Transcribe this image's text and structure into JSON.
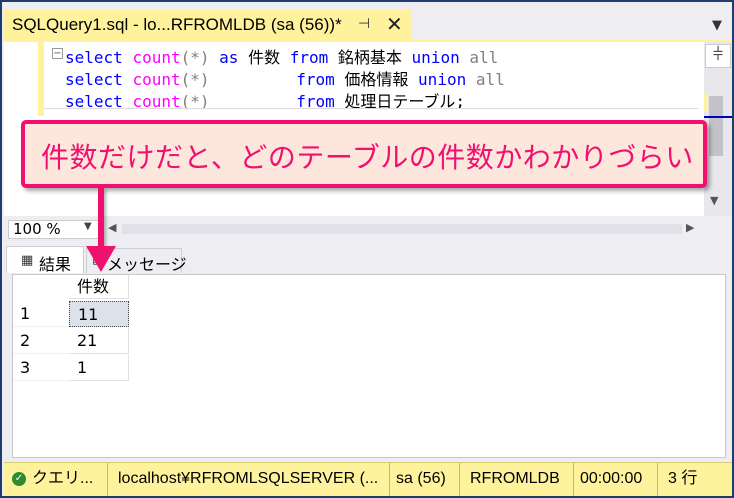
{
  "document_tab": {
    "title": "SQLQuery1.sql - lo...RFROMLDB (sa (56))*",
    "pin_glyph": "⊣",
    "close_glyph": "✕",
    "dropdown_glyph": "▼"
  },
  "editor": {
    "collapse_glyph": "−",
    "lines": [
      {
        "select": "select",
        "count": "count",
        "args": "(*)",
        "middle_kw": "as",
        "alias": "件数",
        "from": "from",
        "table": "銘柄基本",
        "union": "union",
        "all": "all"
      },
      {
        "select": "select",
        "count": "count",
        "args": "(*)",
        "from": "from",
        "table": "価格情報",
        "union": "union",
        "all": "all"
      },
      {
        "select": "select",
        "count": "count",
        "args": "(*)",
        "from": "from",
        "table": "処理日テーブル;"
      }
    ],
    "split_glyph": "⫩",
    "scroll_down_glyph": "▼"
  },
  "zoom": {
    "value": "100 %",
    "dropdown_glyph": "▼",
    "left_glyph": "◀",
    "right_glyph": "▶"
  },
  "results_tabs": {
    "results_label": "結果",
    "results_icon": "▦",
    "messages_label": "メッセージ",
    "messages_icon": "▤"
  },
  "grid": {
    "column_header": "件数",
    "rows": [
      {
        "num": "1",
        "value": "11"
      },
      {
        "num": "2",
        "value": "21"
      },
      {
        "num": "3",
        "value": "1"
      }
    ]
  },
  "statusbar": {
    "ok_glyph": "✓",
    "query_status": "クエリ...",
    "server": "localhost¥RFROMLSQLSERVER (...",
    "user": "sa (56)",
    "database": "RFROMLDB",
    "elapsed": "00:00:00",
    "rows": "3 行"
  },
  "callout": {
    "text": "件数だけだと、どのテーブルの件数かわかりづらい"
  },
  "colors": {
    "accent_yellow": "#fff29d",
    "callout_pink": "#f0106e",
    "callout_fill": "#fde7dd",
    "keyword_blue": "#0000ff",
    "function_magenta": "#ff00ff",
    "operator_gray": "#808080"
  }
}
